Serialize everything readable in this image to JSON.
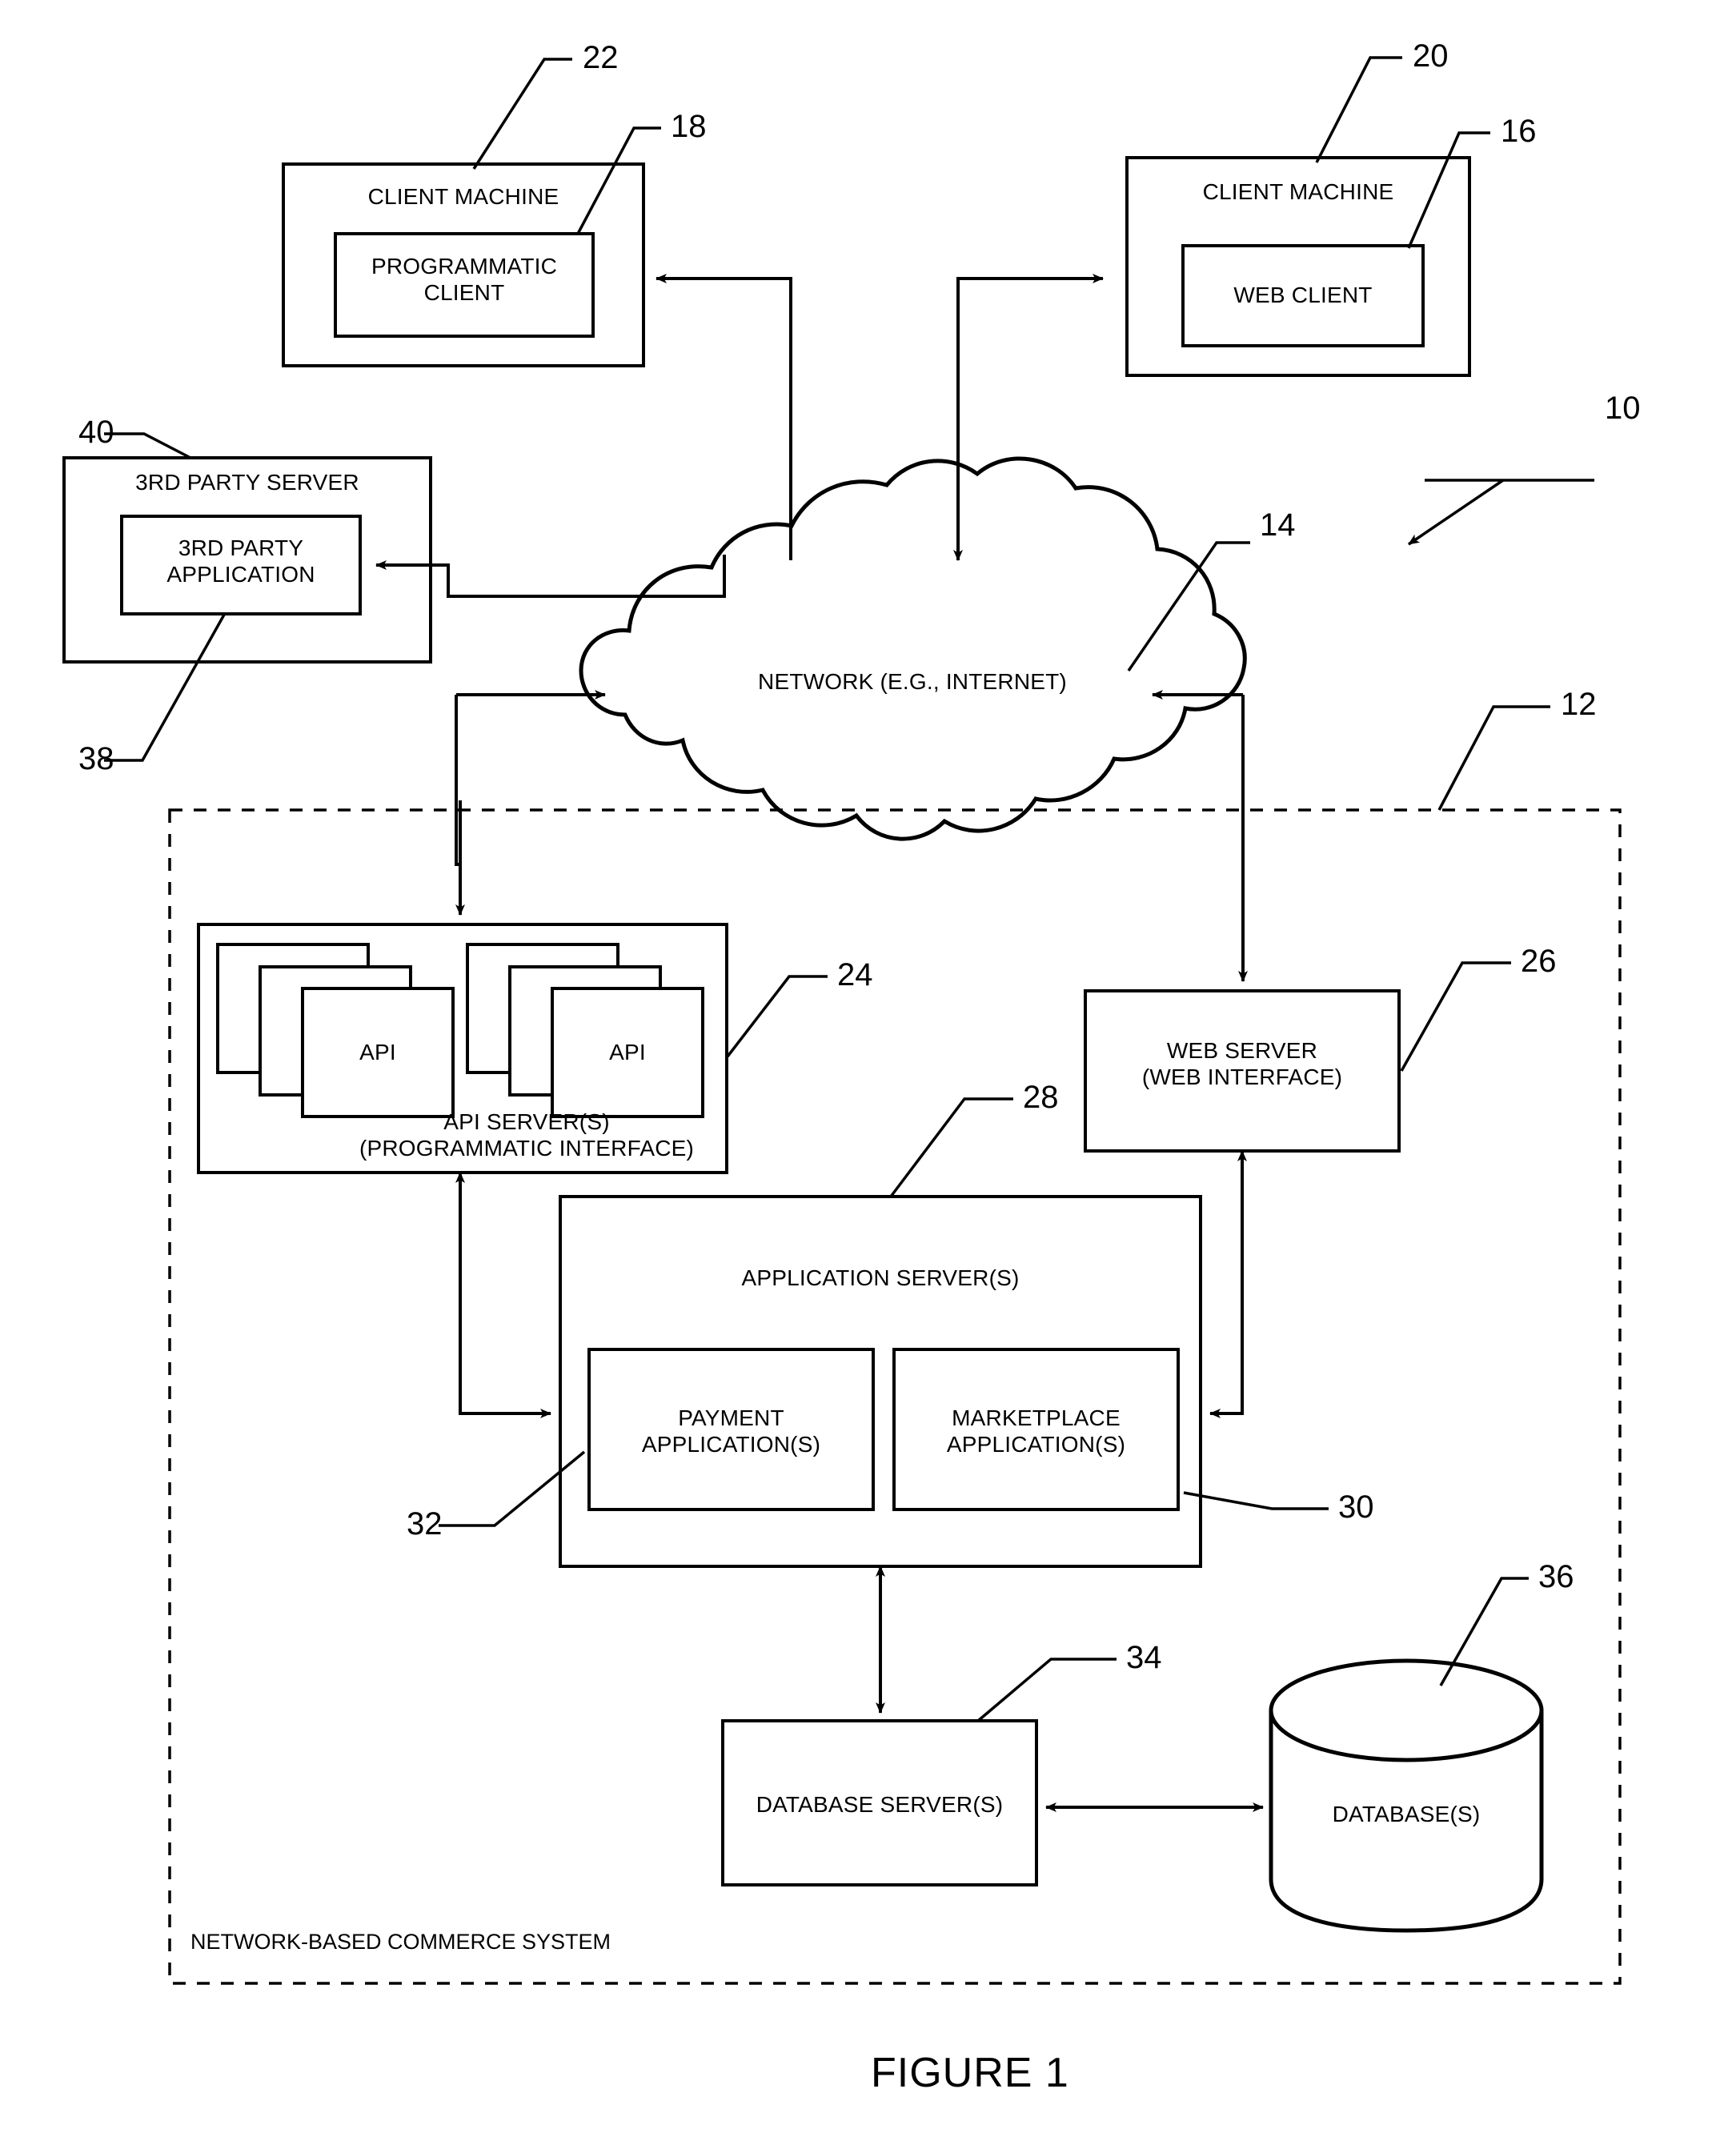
{
  "figure": {
    "caption": "FIGURE 1",
    "system_label": "NETWORK-BASED COMMERCE SYSTEM"
  },
  "nodes": {
    "client_machine_left": {
      "title": "CLIENT MACHINE",
      "inner": "PROGRAMMATIC\nCLIENT"
    },
    "client_machine_right": {
      "title": "CLIENT MACHINE",
      "inner": "WEB CLIENT"
    },
    "third_party_server": {
      "title": "3RD PARTY SERVER",
      "inner": "3RD PARTY\nAPPLICATION"
    },
    "network_cloud": {
      "label": "NETWORK (E.G., INTERNET)"
    },
    "api_server": {
      "title": "API SERVER(S)\n(PROGRAMMATIC INTERFACE)",
      "api_stack_left": "API",
      "api_stack_right": "API"
    },
    "web_server": {
      "title": "WEB SERVER\n(WEB INTERFACE)"
    },
    "application_server": {
      "title": "APPLICATION SERVER(S)",
      "payment_application": "PAYMENT\nAPPLICATION(S)",
      "marketplace_application": "MARKETPLACE\nAPPLICATION(S)"
    },
    "database_server": {
      "title": "DATABASE SERVER(S)"
    },
    "database": {
      "title": "DATABASE(S)"
    }
  },
  "reference_numerals": {
    "n10": "10",
    "n12": "12",
    "n14": "14",
    "n16": "16",
    "n18": "18",
    "n20": "20",
    "n22": "22",
    "n24": "24",
    "n26": "26",
    "n28": "28",
    "n30": "30",
    "n32": "32",
    "n34": "34",
    "n36": "36",
    "n38": "38",
    "n40": "40"
  },
  "colors": {
    "ink": "#000000",
    "paper": "#ffffff"
  }
}
